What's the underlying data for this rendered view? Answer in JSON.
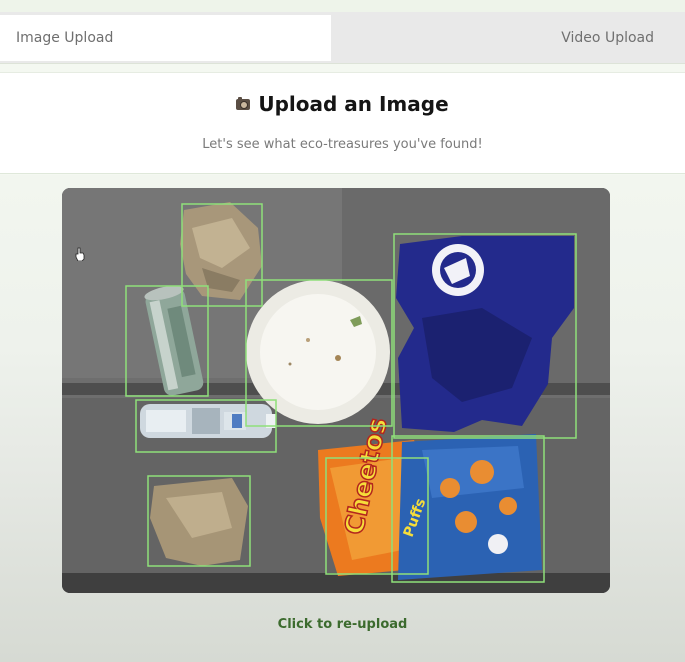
{
  "tabs": [
    {
      "label": "Image Upload",
      "active": true
    },
    {
      "label": "Video Upload",
      "active": false
    }
  ],
  "header": {
    "icon": "camera-icon",
    "title": "Upload an Image",
    "subtitle": "Let's see what eco-treasures you've found!"
  },
  "image": {
    "detection_box_color": "#8fe07a",
    "detections": [
      "crumpled-paper-bag-top",
      "soda-can",
      "paper-plate",
      "blue-t-shirt",
      "plastic-water-bottle",
      "crumpled-paper-bag-bottom",
      "snack-bag-cheetos",
      "snack-bag-puffs"
    ],
    "bag_text": "Cheetos",
    "bag_subtext": "Puffs"
  },
  "actions": {
    "reupload_label": "Click to re-upload"
  },
  "colors": {
    "accent": "#3c6b2e",
    "background": "#f4f8f1"
  }
}
